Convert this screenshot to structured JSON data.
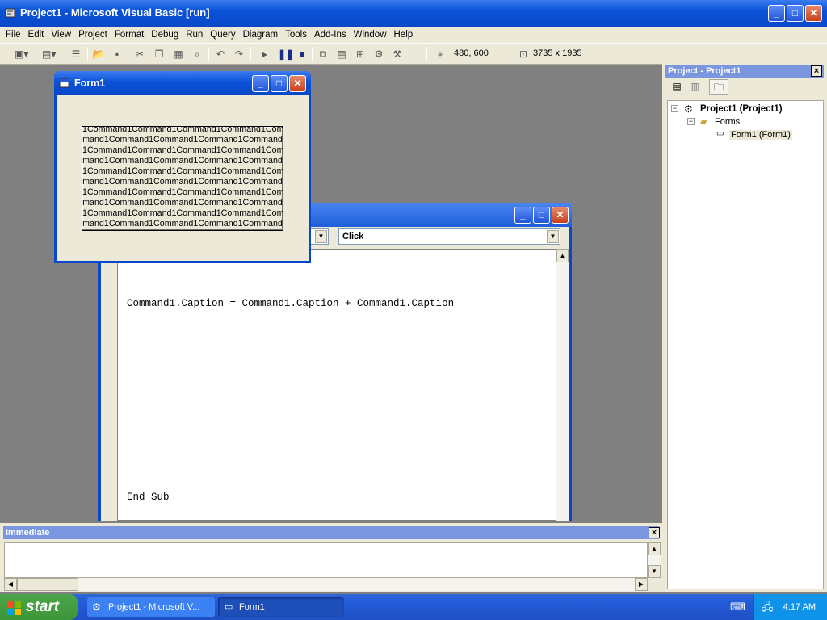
{
  "app": {
    "title": "Project1 - Microsoft Visual Basic [run]",
    "window_buttons": {
      "minimize": "_",
      "maximize": "□",
      "close": "✕"
    }
  },
  "menu": [
    "File",
    "Edit",
    "View",
    "Project",
    "Format",
    "Debug",
    "Run",
    "Query",
    "Diagram",
    "Tools",
    "Add-Ins",
    "Window",
    "Help"
  ],
  "toolbar": {
    "position": "480, 600",
    "size": "3735 x 1935",
    "icons": [
      "add-project-icon",
      "add-form-icon",
      "menu-editor-icon",
      "open-icon",
      "save-icon",
      "cut-icon",
      "copy-icon",
      "paste-icon",
      "find-icon",
      "undo-icon",
      "redo-icon",
      "start-icon",
      "break-icon",
      "end-icon",
      "project-explorer-icon",
      "properties-icon",
      "form-layout-icon",
      "object-browser-icon",
      "toolbox-icon"
    ]
  },
  "form1": {
    "title": "Form1",
    "button_caption_lines": [
      "1Command1Command1Command1Command1Com",
      "mand1Command1Command1Command1Command",
      "1Command1Command1Command1Command1Com",
      "mand1Command1Command1Command1Command",
      "1Command1Command1Command1Command1Com",
      "mand1Command1Command1Command1Command",
      "1Command1Command1Command1Command1Com",
      "mand1Command1Command1Command1Command",
      "1Command1Command1Command1Command1Com",
      "mand1Command1Command1Command1Command"
    ]
  },
  "code_window": {
    "procedure": "Click",
    "lines": [
      "Command1.Caption = Command1.Caption + Command1.Caption",
      "",
      "",
      "",
      "End Sub"
    ]
  },
  "project_panel": {
    "title": "Project - Project1",
    "close": "×",
    "tree": {
      "root": "Project1 (Project1)",
      "folder": "Forms",
      "item": "Form1 (Form1)"
    }
  },
  "immediate": {
    "title": "Immediate",
    "close": "×"
  },
  "taskbar": {
    "start": "start",
    "items": [
      "Project1 - Microsoft V...",
      "Form1"
    ],
    "clock": "4:17 AM"
  }
}
